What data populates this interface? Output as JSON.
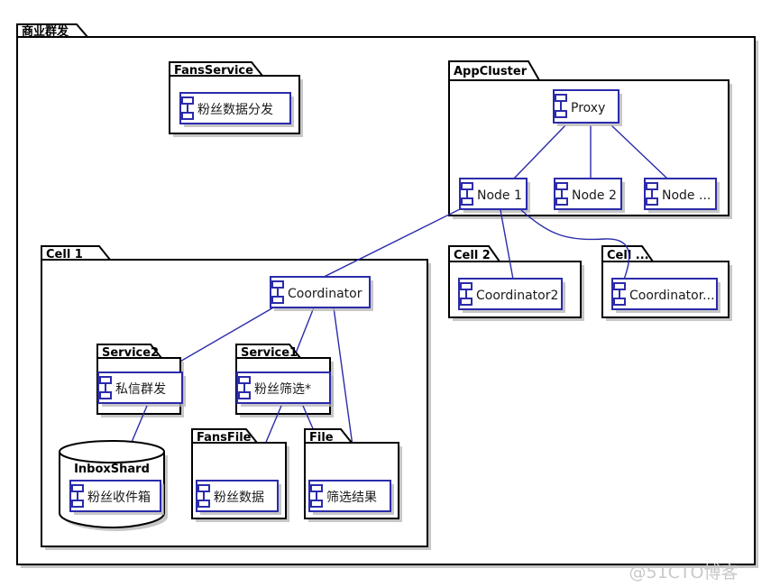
{
  "diagram": {
    "type": "uml-component-diagram",
    "outer_package": {
      "label": "商业群发"
    },
    "packages": [
      {
        "id": "fansservice",
        "label": "FansService"
      },
      {
        "id": "appcluster",
        "label": "AppCluster"
      },
      {
        "id": "cell1",
        "label": "Cell 1"
      },
      {
        "id": "cell2",
        "label": "Cell 2"
      },
      {
        "id": "cellx",
        "label": "Cell ..."
      },
      {
        "id": "service2",
        "label": "Service2"
      },
      {
        "id": "service1",
        "label": "Service1"
      },
      {
        "id": "fansfile",
        "label": "FansFile"
      },
      {
        "id": "file",
        "label": "File"
      }
    ],
    "database": {
      "id": "inboxshard",
      "label": "InboxShard"
    },
    "components": [
      {
        "id": "fenfa",
        "label": "粉丝数据分发"
      },
      {
        "id": "proxy",
        "label": "Proxy"
      },
      {
        "id": "node1",
        "label": "Node 1"
      },
      {
        "id": "node2",
        "label": "Node 2"
      },
      {
        "id": "nodex",
        "label": "Node ..."
      },
      {
        "id": "coordinator",
        "label": "Coordinator"
      },
      {
        "id": "coordinator2",
        "label": "Coordinator2"
      },
      {
        "id": "coordinatorx",
        "label": "Coordinator..."
      },
      {
        "id": "sixin",
        "label": "私信群发"
      },
      {
        "id": "shaixuan",
        "label": "粉丝筛选*"
      },
      {
        "id": "shoujianxiang",
        "label": "粉丝收件箱"
      },
      {
        "id": "fansdata",
        "label": "粉丝数据"
      },
      {
        "id": "shaixuanjg",
        "label": "筛选结果"
      }
    ],
    "connections": [
      {
        "from": "proxy",
        "to": "node1"
      },
      {
        "from": "proxy",
        "to": "node2"
      },
      {
        "from": "proxy",
        "to": "nodex"
      },
      {
        "from": "node1",
        "to": "coordinator"
      },
      {
        "from": "node1",
        "to": "coordinator2"
      },
      {
        "from": "node1",
        "to": "coordinatorx"
      },
      {
        "from": "coordinator",
        "to": "sixin"
      },
      {
        "from": "coordinator",
        "to": "shaixuan"
      },
      {
        "from": "coordinator",
        "to": "shaixuanjg"
      },
      {
        "from": "sixin",
        "to": "shoujianxiang"
      },
      {
        "from": "shaixuan",
        "to": "fansdata"
      },
      {
        "from": "shaixuan",
        "to": "shaixuanjg"
      }
    ],
    "colors": {
      "component_stroke": "#2b2bab",
      "package_stroke": "#000000",
      "background": "#ffffff",
      "link": "#2b2bab",
      "watermark": "#c9c9c9"
    },
    "watermark": "@51CTO博客"
  }
}
